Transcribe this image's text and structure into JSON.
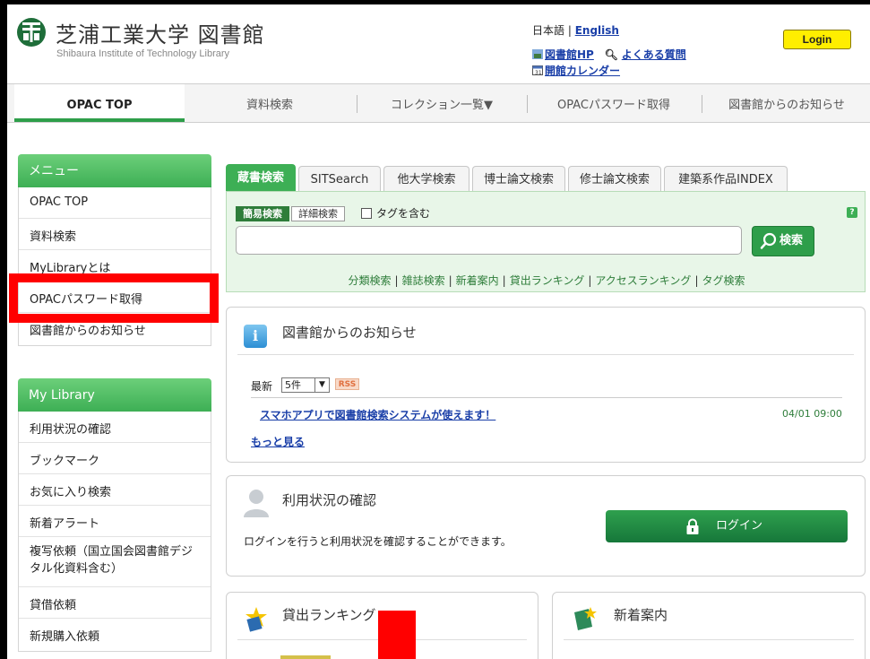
{
  "header": {
    "title": "芝浦工業大学 図書館",
    "subtitle": "Shibaura Institute of Technology Library",
    "lang_current": "日本語",
    "lang_sep": "|",
    "lang_other": "English",
    "link_library_hp": "図書館HP",
    "link_faq": "よくある質問",
    "link_calendar": "開館カレンダー",
    "login_label": "Login"
  },
  "nav": {
    "items": [
      "OPAC TOP",
      "資料検索",
      "コレクション一覧▼",
      "OPACパスワード取得",
      "図書館からのお知らせ"
    ]
  },
  "sidebar": {
    "menu_title": "メニュー",
    "menu_items": [
      "OPAC TOP",
      "資料検索",
      "MyLibraryとは",
      "OPACパスワード取得",
      "図書館からのお知らせ"
    ],
    "mylib_title": "My Library",
    "mylib_items": [
      "利用状況の確認",
      "ブックマーク",
      "お気に入り検索",
      "新着アラート",
      "複写依頼（国立国会図書館デジタル化資料含む）",
      "貸借依頼",
      "新規購入依頼"
    ]
  },
  "search": {
    "tabs": [
      "蔵書検索",
      "SITSearch",
      "他大学検索",
      "博士論文検索",
      "修士論文検索",
      "建築系作品INDEX"
    ],
    "mode_simple": "簡易検索",
    "mode_detail": "詳細検索",
    "tag_label": "タグを含む",
    "help": "?",
    "query_value": "",
    "button_label": "検索",
    "links": [
      "分類検索",
      "雑誌検索",
      "新着案内",
      "貸出ランキング",
      "アクセスランキング",
      "タグ検索"
    ],
    "link_sep": "|"
  },
  "news": {
    "title": "図書館からのお知らせ",
    "latest_label": "最新",
    "count_option": "5件",
    "rss": "RSS",
    "items": [
      {
        "text": "スマホアプリで図書館検索システムが使えます！",
        "date": "04/01 09:00"
      }
    ],
    "more": "もっと見る"
  },
  "usage": {
    "title": "利用状況の確認",
    "text": "ログインを行うと利用状況を確認することができます。",
    "button": "ログイン"
  },
  "ranking": {
    "title": "貸出ランキング"
  },
  "newarrivals": {
    "title": "新着案内"
  }
}
